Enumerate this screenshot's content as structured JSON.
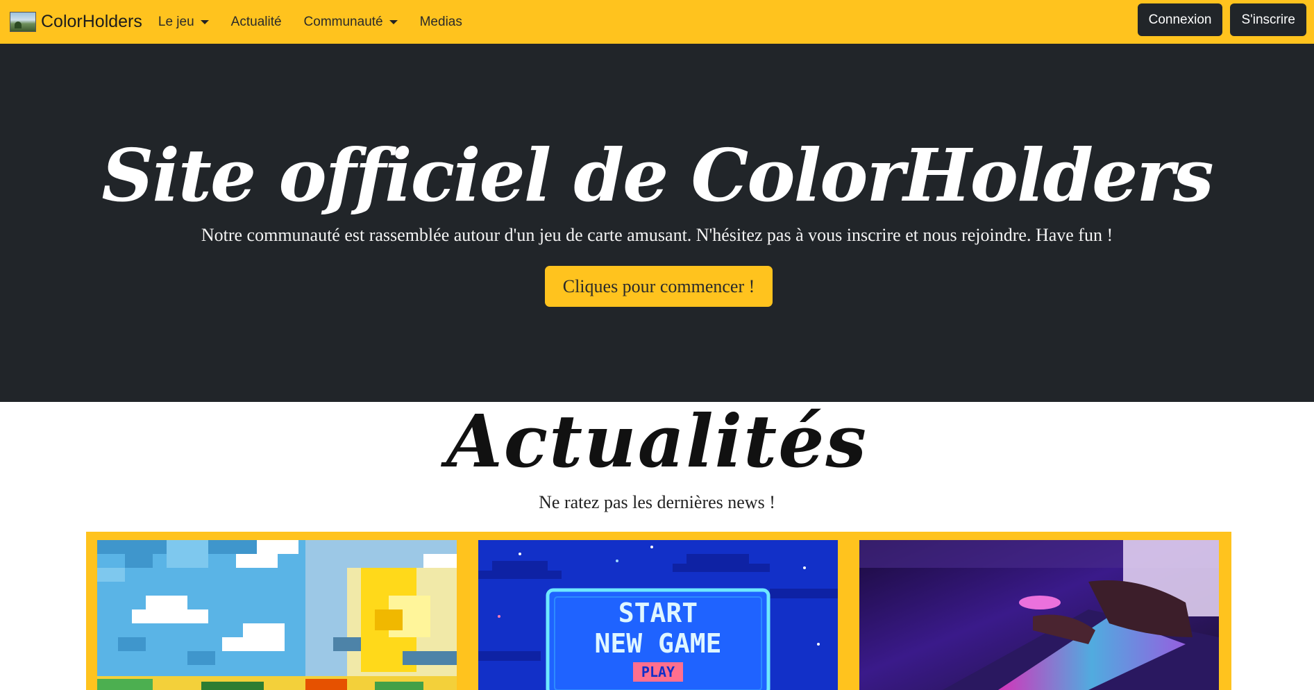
{
  "navbar": {
    "brand": "ColorHolders",
    "links": [
      {
        "label": "Le jeu",
        "dropdown": true
      },
      {
        "label": "Actualité",
        "dropdown": false
      },
      {
        "label": "Communauté",
        "dropdown": true
      },
      {
        "label": "Medias",
        "dropdown": false
      }
    ],
    "login_label": "Connexion",
    "signup_label": "S'inscrire"
  },
  "hero": {
    "title": "Site officiel de ColorHolders",
    "subtitle": "Notre communauté est rassemblée autour d'un jeu de carte amusant. N'hésitez pas à vous inscrire et nous rejoindre. Have fun !",
    "cta_label": "Cliques pour commencer !"
  },
  "news": {
    "title": "Actualités",
    "subtitle": "Ne ratez pas les dernières news !",
    "cards": [
      {
        "image": "pixel-sky-moon"
      },
      {
        "image": "pixel-start-screen",
        "line1": "START",
        "line2": "NEW GAME",
        "badge": "PLAY"
      },
      {
        "image": "gamer-keyboard-photo"
      }
    ]
  },
  "colors": {
    "accent": "#ffc31e",
    "dark": "#212529"
  }
}
